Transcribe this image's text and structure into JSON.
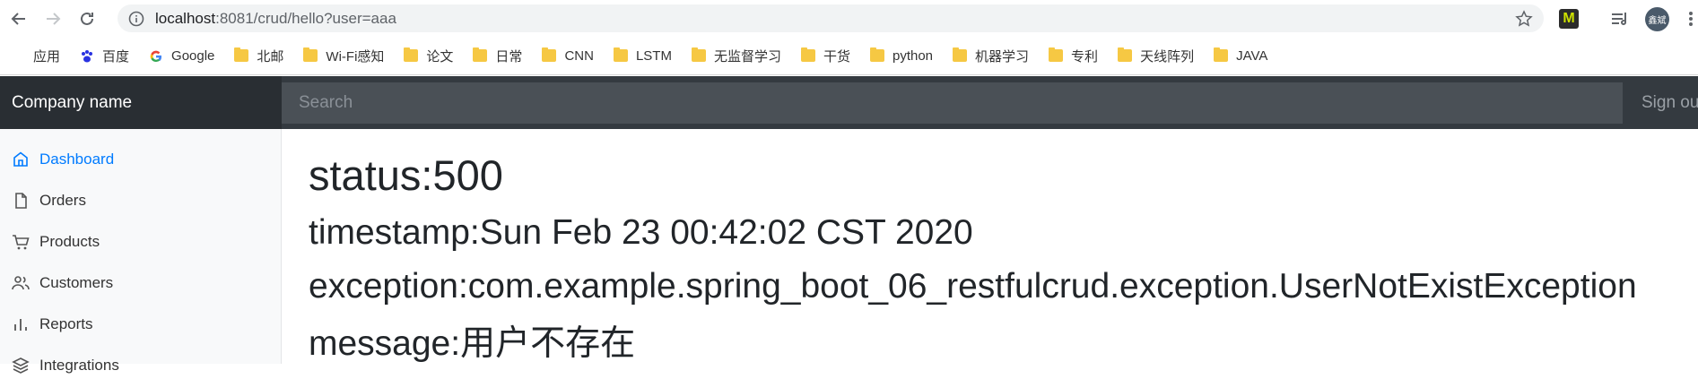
{
  "browser": {
    "url_host": "localhost",
    "url_rest": ":8081/crud/hello?user=aaa",
    "bookmarks": [
      {
        "label": "应用",
        "icon": "apps-grid-icon"
      },
      {
        "label": "百度",
        "icon": "baidu-paw-icon"
      },
      {
        "label": "Google",
        "icon": "google-g-icon"
      },
      {
        "label": "北邮",
        "icon": "folder-icon"
      },
      {
        "label": "Wi-Fi感知",
        "icon": "folder-icon"
      },
      {
        "label": "论文",
        "icon": "folder-icon"
      },
      {
        "label": "日常",
        "icon": "folder-icon"
      },
      {
        "label": "CNN",
        "icon": "folder-icon"
      },
      {
        "label": "LSTM",
        "icon": "folder-icon"
      },
      {
        "label": "无监督学习",
        "icon": "folder-icon"
      },
      {
        "label": "干货",
        "icon": "folder-icon"
      },
      {
        "label": "python",
        "icon": "folder-icon"
      },
      {
        "label": "机器学习",
        "icon": "folder-icon"
      },
      {
        "label": "专利",
        "icon": "folder-icon"
      },
      {
        "label": "天线阵列",
        "icon": "folder-icon"
      },
      {
        "label": "JAVA",
        "icon": "folder-icon"
      }
    ],
    "extension_m_label": "M",
    "avatar_label": "鑫斌"
  },
  "navbar": {
    "brand": "Company name",
    "search_placeholder": "Search",
    "signout_label": "Sign out"
  },
  "sidebar": {
    "items": [
      {
        "label": "Dashboard",
        "icon": "home-icon",
        "active": true
      },
      {
        "label": "Orders",
        "icon": "file-icon",
        "active": false
      },
      {
        "label": "Products",
        "icon": "shopping-cart-icon",
        "active": false
      },
      {
        "label": "Customers",
        "icon": "users-icon",
        "active": false
      },
      {
        "label": "Reports",
        "icon": "bar-chart-icon",
        "active": false
      },
      {
        "label": "Integrations",
        "icon": "layers-icon",
        "active": false
      }
    ]
  },
  "error": {
    "status": "status:500",
    "timestamp": "timestamp:Sun Feb 23 00:42:02 CST 2020",
    "exception": "exception:com.example.spring_boot_06_restfulcrud.exception.UserNotExistException",
    "message": "message:用户不存在"
  },
  "colors": {
    "accent": "#007bff",
    "navbar_bg": "#343a40",
    "brand_bg": "#292e33",
    "folder": "#f6c843"
  }
}
